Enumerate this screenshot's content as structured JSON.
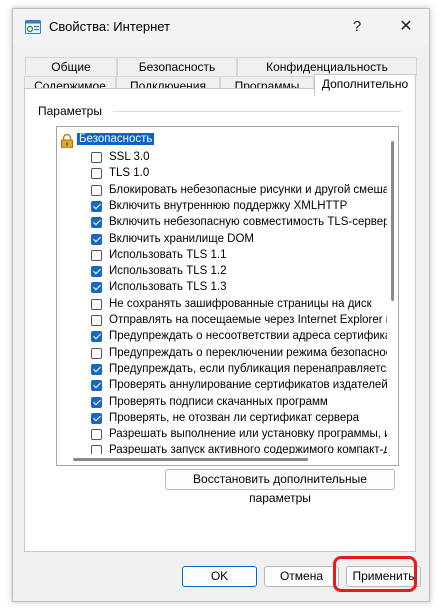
{
  "window": {
    "title": "Свойства: Интернет",
    "help_label": "?",
    "close_label": "✕"
  },
  "tabs_top": [
    "Общие",
    "Безопасность",
    "Конфиденциальность"
  ],
  "tabs_bottom": [
    "Содержимое",
    "Подключения",
    "Программы",
    "Дополнительно"
  ],
  "active_tab": "Дополнительно",
  "group": {
    "label": "Параметры"
  },
  "settings": {
    "category": "Безопасность",
    "items": [
      {
        "label": "SSL 3.0",
        "checked": false
      },
      {
        "label": "TLS 1.0",
        "checked": false
      },
      {
        "label": "Блокировать небезопасные рисунки и другой смешанн",
        "checked": false
      },
      {
        "label": "Включить внутреннюю поддержку XMLHTTP",
        "checked": true
      },
      {
        "label": "Включить небезопасную совместимость TLS-сервера",
        "checked": true
      },
      {
        "label": "Включить хранилище DOM",
        "checked": true
      },
      {
        "label": "Использовать TLS 1.1",
        "checked": false
      },
      {
        "label": "Использовать TLS 1.2",
        "checked": true
      },
      {
        "label": "Использовать TLS 1.3",
        "checked": true
      },
      {
        "label": "Не сохранять зашифрованные страницы на диск",
        "checked": false
      },
      {
        "label": "Отправлять на посещаемые через Internet Explorer ве",
        "checked": false
      },
      {
        "label": "Предупреждать о несоответствии адреса сертификат",
        "checked": true
      },
      {
        "label": "Предупреждать о переключении режима безопасност",
        "checked": false
      },
      {
        "label": "Предупреждать, если публикация перенаправляется",
        "checked": true
      },
      {
        "label": "Проверять аннулирование сертификатов издателей",
        "checked": true
      },
      {
        "label": "Проверять подписи скачанных программ",
        "checked": true
      },
      {
        "label": "Проверять, не отозван ли сертификат сервера",
        "checked": true
      },
      {
        "label": "Разрешать выполнение или установку программы, име",
        "checked": false
      },
      {
        "label": "Разрешать запуск активного содержимого компакт-ди",
        "checked": false
      }
    ]
  },
  "buttons": {
    "restore": "Восстановить дополнительные параметры",
    "ok": "OK",
    "cancel": "Отмена",
    "apply": "Применить"
  },
  "colors": {
    "accent": "#1668c4",
    "highlight": "#e8191f"
  }
}
